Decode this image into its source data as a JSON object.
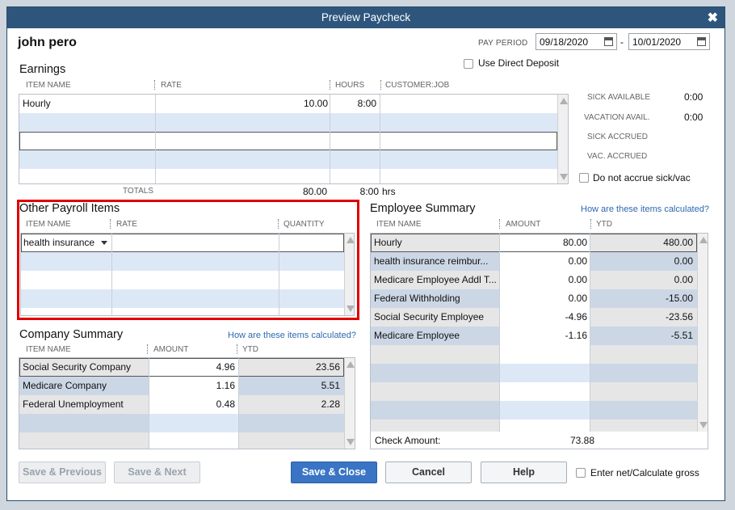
{
  "title": "Preview Paycheck",
  "employee_name": "john pero",
  "pay_period": {
    "label": "PAY PERIOD",
    "start": "09/18/2020",
    "dash": "-",
    "end": "10/01/2020"
  },
  "use_direct_deposit": "Use Direct Deposit",
  "earnings": {
    "title": "Earnings",
    "headers": [
      "ITEM NAME",
      "RATE",
      "HOURS",
      "CUSTOMER:JOB"
    ],
    "rows": [
      {
        "item": "Hourly",
        "rate": "10.00",
        "hours": "8:00",
        "job": ""
      }
    ],
    "totals_label": "TOTALS",
    "total_rate": "80.00",
    "total_hours": "8:00",
    "hrs": "hrs"
  },
  "sick_vac": {
    "sick_available_label": "SICK AVAILABLE",
    "sick_available": "0:00",
    "vac_avail_label": "VACATION AVAIL.",
    "vac_avail": "0:00",
    "sick_accrued_label": "SICK ACCRUED",
    "vac_accrued_label": "VAC. ACCRUED",
    "do_not_accrue": "Do not accrue sick/vac"
  },
  "other_payroll": {
    "title": "Other Payroll Items",
    "headers": [
      "ITEM NAME",
      "RATE",
      "QUANTITY"
    ],
    "first_item": "health insurance"
  },
  "employee_summary": {
    "title": "Employee Summary",
    "link": "How are these items calculated?",
    "headers": [
      "ITEM NAME",
      "AMOUNT",
      "YTD"
    ],
    "rows": [
      {
        "item": "Hourly",
        "amount": "80.00",
        "ytd": "480.00"
      },
      {
        "item": "health insurance reimbur...",
        "amount": "0.00",
        "ytd": "0.00"
      },
      {
        "item": "Medicare Employee Addl T...",
        "amount": "0.00",
        "ytd": "0.00"
      },
      {
        "item": "Federal Withholding",
        "amount": "0.00",
        "ytd": "-15.00"
      },
      {
        "item": "Social Security Employee",
        "amount": "-4.96",
        "ytd": "-23.56"
      },
      {
        "item": "Medicare Employee",
        "amount": "-1.16",
        "ytd": "-5.51"
      }
    ],
    "check_amount_label": "Check Amount:",
    "check_amount": "73.88"
  },
  "company_summary": {
    "title": "Company Summary",
    "link": "How are these items calculated?",
    "headers": [
      "ITEM NAME",
      "AMOUNT",
      "YTD"
    ],
    "rows": [
      {
        "item": "Social Security Company",
        "amount": "4.96",
        "ytd": "23.56"
      },
      {
        "item": "Medicare Company",
        "amount": "1.16",
        "ytd": "5.51"
      },
      {
        "item": "Federal Unemployment",
        "amount": "0.48",
        "ytd": "2.28"
      }
    ]
  },
  "buttons": {
    "save_previous": "Save & Previous",
    "save_next": "Save & Next",
    "save_close": "Save & Close",
    "cancel": "Cancel",
    "help": "Help"
  },
  "enter_net": "Enter net/Calculate gross",
  "colors": {
    "titlebar": "#2e567d",
    "row_blue": "#dde8f7",
    "highlight_red": "#e00000",
    "primary_button": "#3a74c4"
  }
}
